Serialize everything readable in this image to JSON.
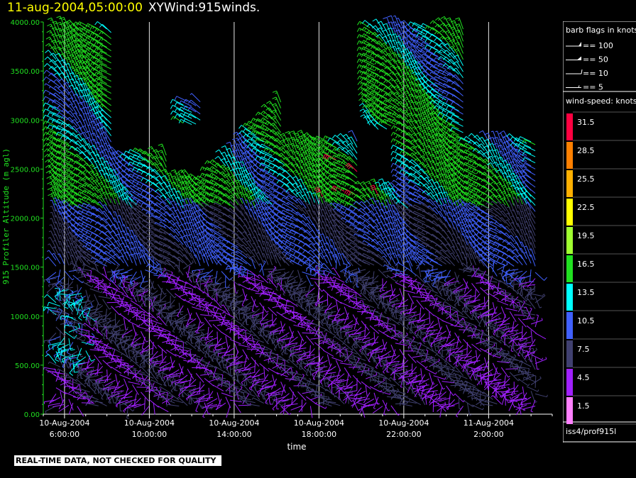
{
  "header": {
    "date": "11-aug-2004,05:00:00",
    "product": "XYWind:915winds."
  },
  "footer": {
    "qc_notice": "REAL-TIME DATA, NOT CHECKED FOR QUALITY",
    "station": "iss4/prof915l"
  },
  "legend": {
    "barb_title": "barb flags in knots",
    "barbs": [
      "== 100",
      "== 50",
      "== 10",
      "== 5"
    ],
    "speed_title": "wind-speed: knots",
    "speed_bins": [
      {
        "label": "31.5",
        "color": "#ff0040"
      },
      {
        "label": "28.5",
        "color": "#ff8000"
      },
      {
        "label": "25.5",
        "color": "#ffb000"
      },
      {
        "label": "22.5",
        "color": "#ffff00"
      },
      {
        "label": "19.5",
        "color": "#a0ff30"
      },
      {
        "label": "16.5",
        "color": "#20e020"
      },
      {
        "label": "13.5",
        "color": "#00ffff"
      },
      {
        "label": "10.5",
        "color": "#4060ff"
      },
      {
        "label": "7.5",
        "color": "#404070"
      },
      {
        "label": "4.5",
        "color": "#a020ff"
      },
      {
        "label": "1.5",
        "color": "#ff80ff"
      }
    ]
  },
  "chart_data": {
    "type": "scatter",
    "ylabel": "915 Profiler Altitude (m agl)",
    "xlabel": "time",
    "ylim": [
      0,
      4000
    ],
    "yticks": [
      "0.00",
      "500.00",
      "1000.00",
      "1500.00",
      "2000.00",
      "2500.00",
      "3000.00",
      "3500.00",
      "4000.00"
    ],
    "xticks": [
      {
        "date": "10-Aug-2004",
        "time": "6:00:00"
      },
      {
        "date": "10-Aug-2004",
        "time": "10:00:00"
      },
      {
        "date": "10-Aug-2004",
        "time": "14:00:00"
      },
      {
        "date": "10-Aug-2004",
        "time": "18:00:00"
      },
      {
        "date": "10-Aug-2004",
        "time": "22:00:00"
      },
      {
        "date": "11-Aug-2004",
        "time": "2:00:00"
      }
    ],
    "xlim_hours": [
      5.0,
      29.0
    ],
    "grid": "vertical"
  }
}
